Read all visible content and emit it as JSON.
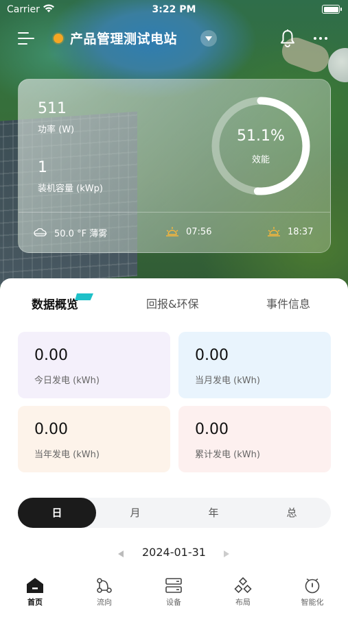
{
  "status_bar": {
    "carrier": "Carrier",
    "time": "3:22 PM"
  },
  "header": {
    "station_name": "产品管理测试电站",
    "status_color": "#f5a623"
  },
  "overview": {
    "power_value": "511",
    "power_label": "功率 (W)",
    "capacity_value": "1",
    "capacity_label": "装机容量 (kWp)",
    "efficiency_value": "51.1%",
    "efficiency_label": "效能",
    "efficiency_percent": 51.1,
    "weather_text": "50.0 °F 薄雾",
    "sunrise": "07:56",
    "sunset": "18:37"
  },
  "tabs": [
    {
      "label": "数据概览",
      "active": true
    },
    {
      "label": "回报&环保",
      "active": false
    },
    {
      "label": "事件信息",
      "active": false
    }
  ],
  "stats": [
    {
      "value": "0.00",
      "label": "今日发电 (kWh)",
      "color": "#f4f0fb"
    },
    {
      "value": "0.00",
      "label": "当月发电 (kWh)",
      "color": "#e9f4fd"
    },
    {
      "value": "0.00",
      "label": "当年发电 (kWh)",
      "color": "#fdf3ea"
    },
    {
      "value": "0.00",
      "label": "累计发电 (kWh)",
      "color": "#fdf0ef"
    }
  ],
  "segments": [
    {
      "label": "日",
      "active": true
    },
    {
      "label": "月",
      "active": false
    },
    {
      "label": "年",
      "active": false
    },
    {
      "label": "总",
      "active": false
    }
  ],
  "date": "2024-01-31",
  "nav": [
    {
      "label": "首页",
      "icon": "home-icon",
      "active": true
    },
    {
      "label": "流向",
      "icon": "flow-icon",
      "active": false
    },
    {
      "label": "设备",
      "icon": "device-icon",
      "active": false
    },
    {
      "label": "布局",
      "icon": "layout-icon",
      "active": false
    },
    {
      "label": "智能化",
      "icon": "smart-icon",
      "active": false
    }
  ],
  "colors": {
    "accent": "#1ec0c8",
    "dark": "#1b1b1b"
  }
}
